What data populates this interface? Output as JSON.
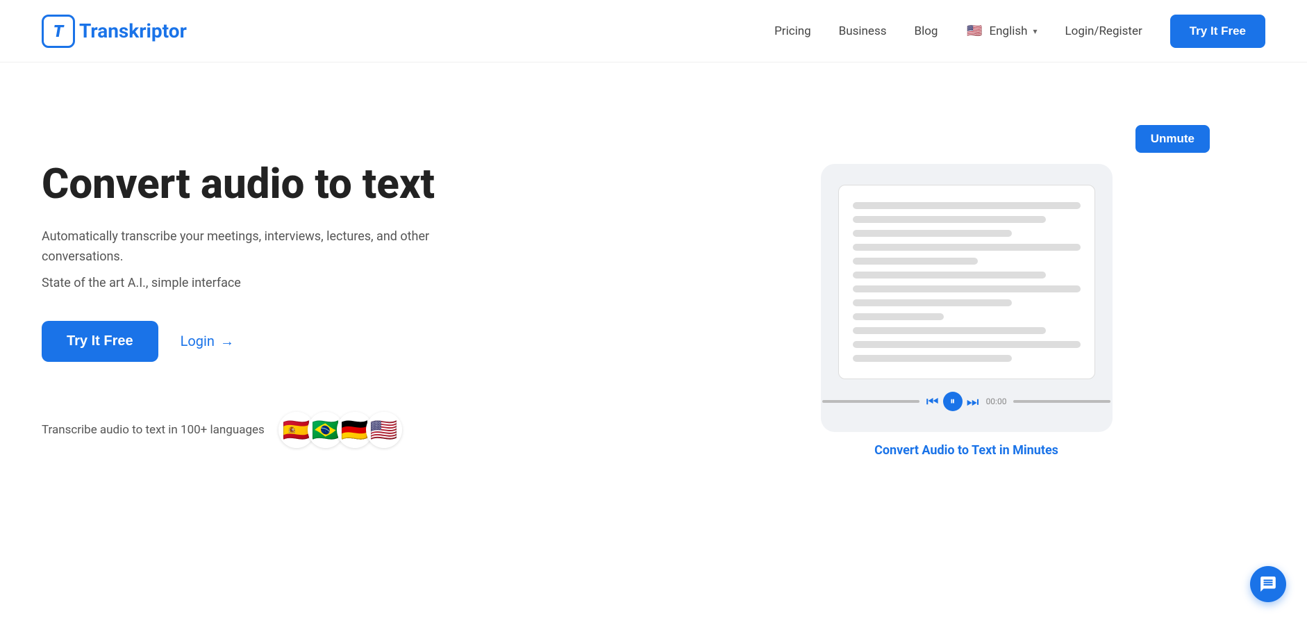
{
  "brand": {
    "logo_letter": "T",
    "logo_name": "ranskriptor"
  },
  "navbar": {
    "pricing_label": "Pricing",
    "business_label": "Business",
    "blog_label": "Blog",
    "lang_label": "English",
    "lang_flag": "🇺🇸",
    "login_label": "Login/Register",
    "cta_label": "Try It Free"
  },
  "hero": {
    "title": "Convert audio to text",
    "subtitle1": "Automatically transcribe your meetings, interviews, lectures, and other conversations.",
    "subtitle2": "State of the art A.I., simple interface",
    "cta_label": "Try It Free",
    "login_label": "Login",
    "login_arrow": "→",
    "lang_text": "Transcribe audio to text in 100+ languages",
    "flags": [
      "🇪🇸",
      "🇧🇷",
      "🇩🇪",
      "🇺🇸"
    ]
  },
  "video_card": {
    "unmute_label": "Unmute",
    "caption": "Convert Audio to Text in Minutes"
  },
  "playback": {
    "time": "00:00"
  }
}
